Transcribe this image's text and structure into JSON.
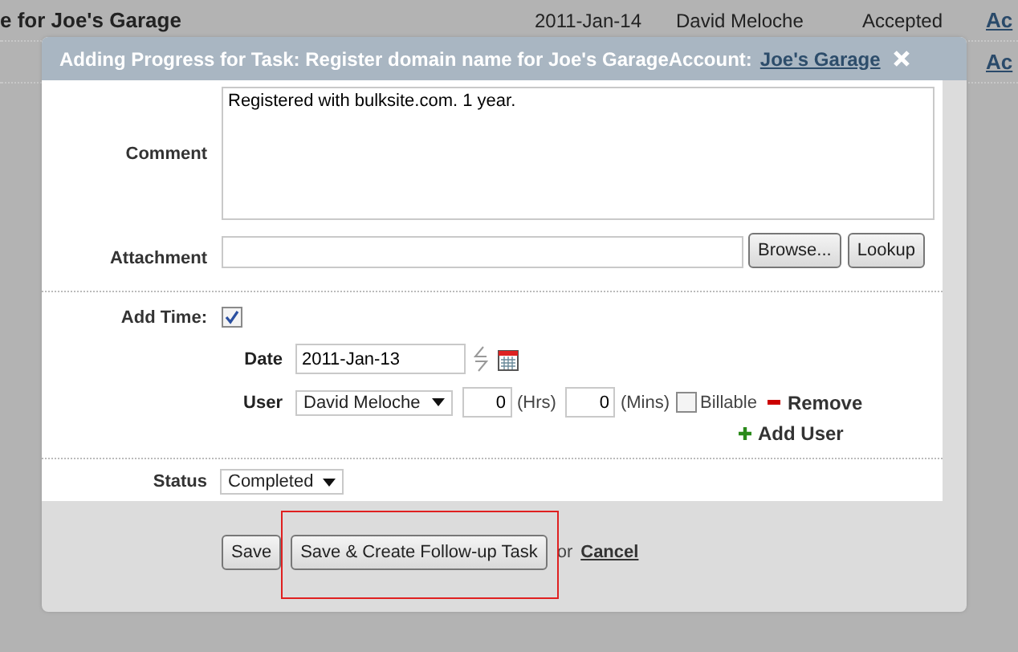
{
  "background_table": {
    "rows": [
      {
        "task": "e for Joe's Garage",
        "date": "2011-Jan-14",
        "user": "David Meloche",
        "status": "Accepted",
        "action": "Ac"
      },
      {
        "action": "Ac"
      }
    ]
  },
  "dialog": {
    "title": "Adding Progress for Task: Register domain name for Joe's GarageAccount:",
    "title_link": "Joe's Garage",
    "comment": {
      "label": "Comment",
      "value": "Registered with bulksite.com. 1 year."
    },
    "attachment": {
      "label": "Attachment",
      "buttons": [
        "Browse...",
        "Lookup"
      ]
    },
    "add_time": {
      "label": "Add Time:",
      "checked": true
    },
    "date": {
      "label": "Date",
      "value": "2011-Jan-13"
    },
    "user": {
      "label": "User",
      "value": "David Meloche",
      "hours": "0",
      "hours_unit": "(Hrs)",
      "minutes": "0",
      "minutes_unit": "(Mins)",
      "billable": {
        "label": "Billable",
        "checked": false
      },
      "remove": "Remove"
    },
    "add_user": "Add User",
    "status": {
      "label": "Status",
      "value": "Completed"
    },
    "footer": {
      "save": "Save",
      "save_follow_up": "Save & Create Follow-up Task",
      "or": "or",
      "cancel": "Cancel"
    }
  }
}
